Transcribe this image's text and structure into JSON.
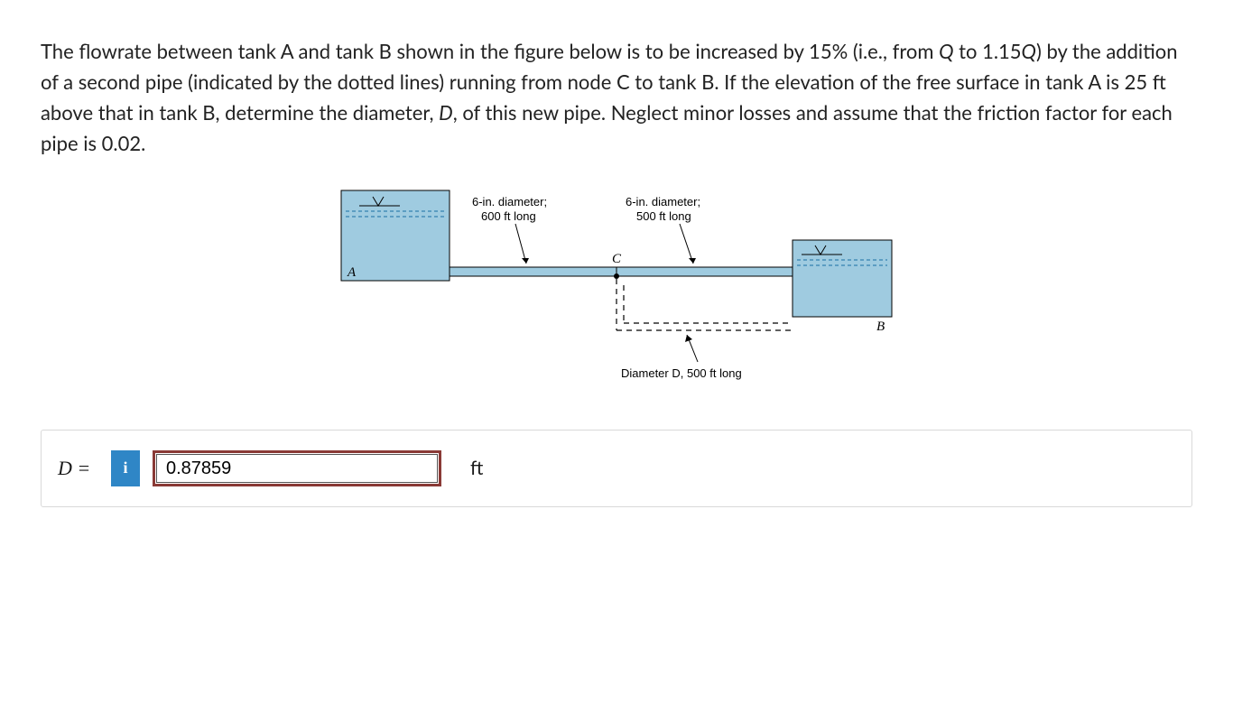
{
  "problem": {
    "text_before_em1": "The flowrate between tank A and tank B shown in the figure below is to be increased by 15% (i.e., from ",
    "em1": "Q",
    "text_mid1": " to 1.15",
    "em2": "Q",
    "text_mid2": ") by the addition of a second pipe (indicated by the dotted lines) running from node C to tank B. If the elevation of the free surface in tank A is 25 ft above that in tank B, determine the diameter, ",
    "em3": "D",
    "text_after": ", of this new pipe. Neglect minor losses and assume that the friction factor for each pipe is 0.02."
  },
  "figure": {
    "pipe1_label1": "6-in. diameter;",
    "pipe1_label2": "600 ft long",
    "pipe2_label1": "6-in. diameter;",
    "pipe2_label2": "500 ft long",
    "tankA": "A",
    "tankB": "B",
    "nodeC": "C",
    "newpipe_label": "Diameter D, 500 ft long"
  },
  "answer": {
    "label": "D =",
    "info": "i",
    "value": "0.87859",
    "unit": "ft"
  }
}
